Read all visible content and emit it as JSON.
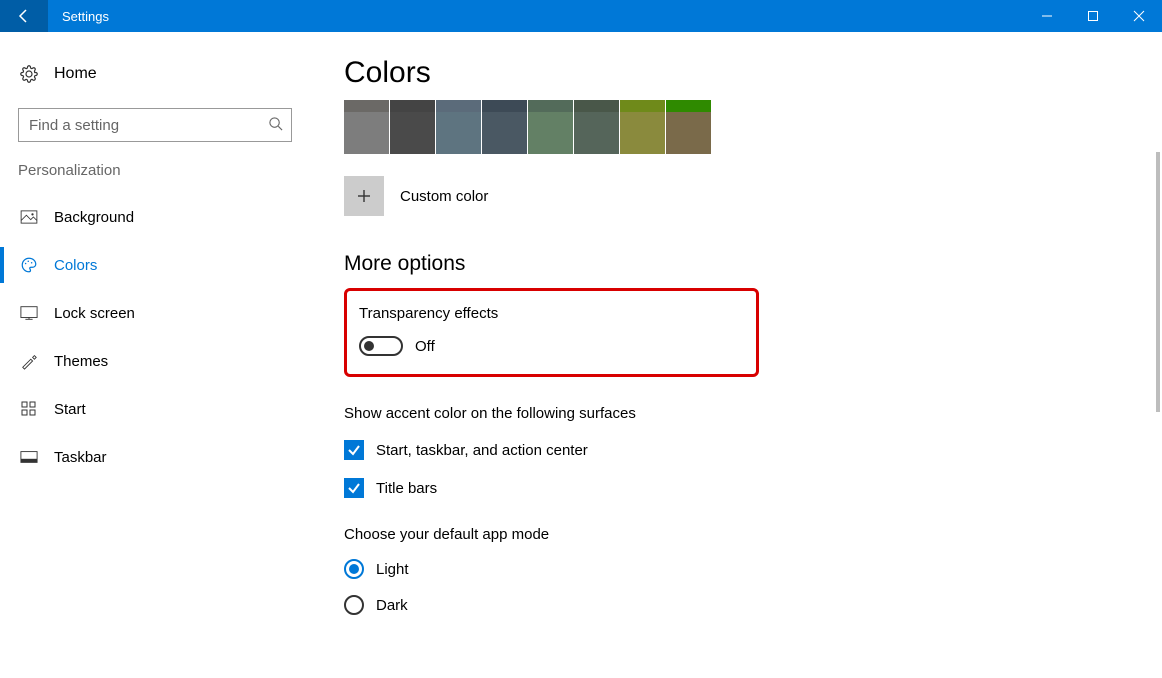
{
  "titlebar": {
    "title": "Settings"
  },
  "sidebar": {
    "home": "Home",
    "searchPlaceholder": "Find a setting",
    "section": "Personalization",
    "items": [
      {
        "label": "Background",
        "active": false
      },
      {
        "label": "Colors",
        "active": true
      },
      {
        "label": "Lock screen",
        "active": false
      },
      {
        "label": "Themes",
        "active": false
      },
      {
        "label": "Start",
        "active": false
      },
      {
        "label": "Taskbar",
        "active": false
      }
    ]
  },
  "content": {
    "title": "Colors",
    "swatches": {
      "rowTop": [
        "#6b6966",
        "#444444",
        "#5b6b7a",
        "#3d4a56",
        "#536b5a",
        "#495749",
        "#6f8a1a",
        "#2f8a00"
      ],
      "rowMain": [
        "#7d7d7d",
        "#4a4a4a",
        "#5e7480",
        "#4a5863",
        "#638065",
        "#55655a",
        "#8a8a3d",
        "#7a6a4a"
      ]
    },
    "customColor": "Custom color",
    "moreOptions": "More options",
    "transparency": {
      "label": "Transparency effects",
      "state": "Off"
    },
    "accentSurfaces": {
      "label": "Show accent color on the following surfaces",
      "options": [
        {
          "label": "Start, taskbar, and action center",
          "checked": true
        },
        {
          "label": "Title bars",
          "checked": true
        }
      ]
    },
    "appMode": {
      "label": "Choose your default app mode",
      "options": [
        {
          "label": "Light",
          "selected": true
        },
        {
          "label": "Dark",
          "selected": false
        }
      ]
    }
  }
}
